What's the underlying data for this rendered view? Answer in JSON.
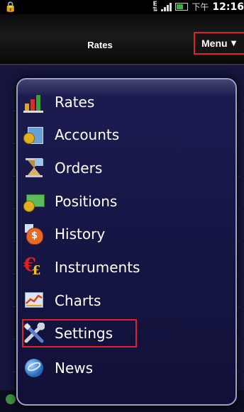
{
  "status_bar": {
    "left_icon": "lock-icon",
    "e_label": "E",
    "time_prefix": "下午",
    "time": "12:16"
  },
  "title_bar": {
    "title": "Rates",
    "menu_button": "Menu"
  },
  "menu": {
    "items": [
      {
        "label": "Rates",
        "icon": "bar-chart-icon"
      },
      {
        "label": "Accounts",
        "icon": "accounts-book-icon"
      },
      {
        "label": "Orders",
        "icon": "hourglass-icon"
      },
      {
        "label": "Positions",
        "icon": "money-coins-icon"
      },
      {
        "label": "History",
        "icon": "money-bag-icon"
      },
      {
        "label": "Instruments",
        "icon": "currency-icon"
      },
      {
        "label": "Charts",
        "icon": "line-chart-icon"
      },
      {
        "label": "Settings",
        "icon": "tools-icon"
      },
      {
        "label": "News",
        "icon": "globe-icon"
      }
    ],
    "highlighted": "Settings"
  },
  "colors": {
    "highlight_border": "#e0202a",
    "popup_border": "#9aa0cf",
    "popup_bg": "#1c1c52"
  }
}
